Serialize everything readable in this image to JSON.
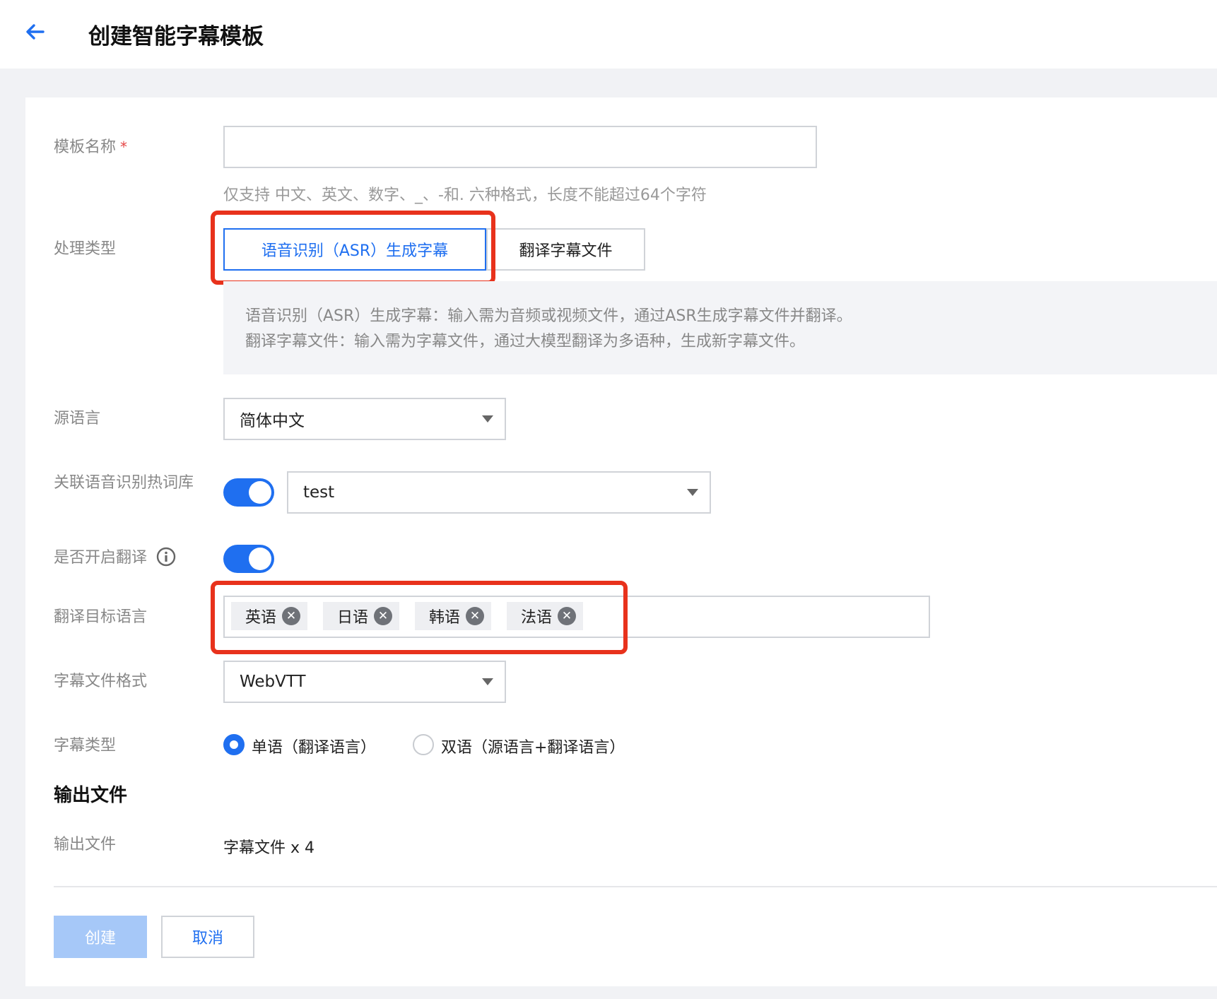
{
  "header": {
    "title": "创建智能字幕模板"
  },
  "form": {
    "template_name": {
      "label": "模板名称",
      "required_mark": "*",
      "value": "",
      "hint": "仅支持 中文、英文、数字、_、-和. 六种格式，长度不能超过64个字符"
    },
    "process_type": {
      "label": "处理类型",
      "options": [
        "语音识别（ASR）生成字幕",
        "翻译字幕文件"
      ],
      "selected": "语音识别（ASR）生成字幕",
      "description": [
        "语音识别（ASR）生成字幕：输入需为音频或视频文件，通过ASR生成字幕文件并翻译。",
        "翻译字幕文件：输入需为字幕文件，通过大模型翻译为多语种，生成新字幕文件。"
      ]
    },
    "source_language": {
      "label": "源语言",
      "value": "简体中文"
    },
    "hotword": {
      "label": "关联语音识别热词库",
      "enabled": true,
      "value": "test"
    },
    "translate": {
      "label": "是否开启翻译",
      "info_icon": "info-icon",
      "enabled": true
    },
    "target_languages": {
      "label": "翻译目标语言",
      "tags": [
        "英语",
        "日语",
        "韩语",
        "法语"
      ]
    },
    "file_format": {
      "label": "字幕文件格式",
      "value": "WebVTT"
    },
    "subtitle_type": {
      "label": "字幕类型",
      "options": [
        "单语（翻译语言）",
        "双语（源语言+翻译语言）"
      ],
      "selected": "单语（翻译语言）"
    }
  },
  "output": {
    "section_title": "输出文件",
    "label": "输出文件",
    "value": "字幕文件 x 4"
  },
  "actions": {
    "create": "创建",
    "cancel": "取消"
  },
  "colors": {
    "accent": "#1f6ff0",
    "highlight": "#e8321c",
    "disabled_primary": "#a6c8f8"
  }
}
